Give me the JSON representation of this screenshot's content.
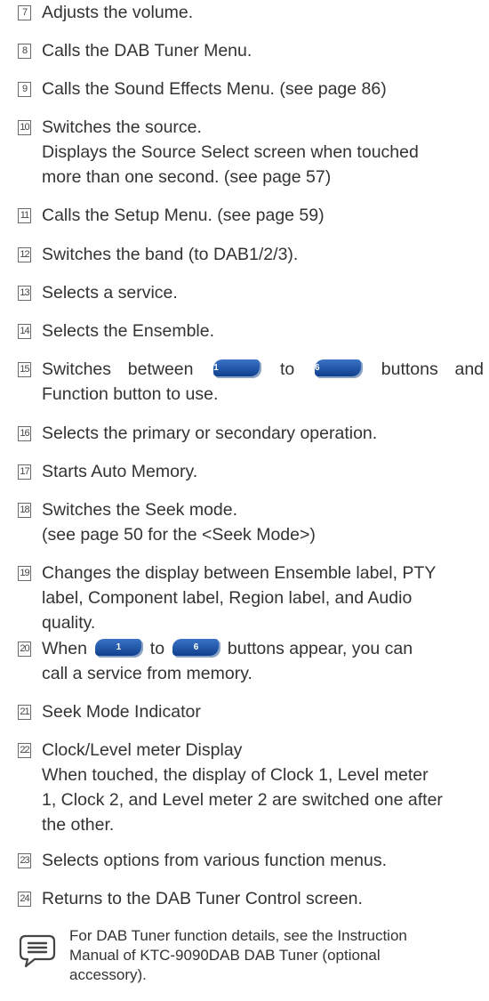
{
  "items": [
    {
      "num": "7",
      "lines": [
        "Adjusts the volume."
      ]
    },
    {
      "num": "8",
      "lines": [
        "Calls the DAB Tuner Menu."
      ]
    },
    {
      "num": "9",
      "lines": [
        "Calls the Sound Effects Menu. (see page 86)"
      ]
    },
    {
      "num": "10",
      "lines": [
        "Switches the source.",
        "Displays the Source Select screen when touched",
        "more than one second. (see page 57)"
      ]
    },
    {
      "num": "11",
      "lines": [
        "Calls the Setup Menu. (see page 59)"
      ]
    },
    {
      "num": "12",
      "lines": [
        "Switches the band (to DAB1/2/3)."
      ]
    },
    {
      "num": "13",
      "lines": [
        "Selects a service."
      ]
    },
    {
      "num": "14",
      "lines": [
        "Selects the Ensemble."
      ]
    },
    {
      "num": "15",
      "pre": "Switches between",
      "mid": "to",
      "post": "buttons and",
      "line2": "Function button to use.",
      "btn1": "1",
      "btn2": "6"
    },
    {
      "num": "16",
      "lines": [
        "Selects the primary or secondary operation."
      ]
    },
    {
      "num": "17",
      "lines": [
        "Starts Auto Memory."
      ]
    },
    {
      "num": "18",
      "lines": [
        "Switches the Seek mode.",
        "(see page 50 for the <Seek Mode>)"
      ]
    },
    {
      "num": "19",
      "lines": [
        "Changes the display between Ensemble label, PTY",
        "label, Component label, Region label, and Audio",
        "quality."
      ]
    },
    {
      "num": "20",
      "pre": "When",
      "mid": "to",
      "post": "buttons appear, you can",
      "line2": "call a service from memory.",
      "btn1": "1",
      "btn2": "6"
    },
    {
      "num": "21",
      "lines": [
        "Seek Mode Indicator"
      ]
    },
    {
      "num": "22",
      "lines": [
        "Clock/Level meter Display",
        "When touched, the display of Clock 1, Level meter",
        "1, Clock 2, and Level meter 2 are switched one after",
        "the other."
      ]
    },
    {
      "num": "23",
      "lines": [
        "Selects options from various function menus."
      ]
    },
    {
      "num": "24",
      "lines": [
        "Returns to the DAB Tuner Control screen."
      ]
    }
  ],
  "note": {
    "icon": "note-speech-bubble-icon",
    "lines": [
      "For DAB Tuner function details, see the Instruction",
      "Manual of KTC-9090DAB DAB Tuner (optional",
      "accessory)."
    ]
  }
}
